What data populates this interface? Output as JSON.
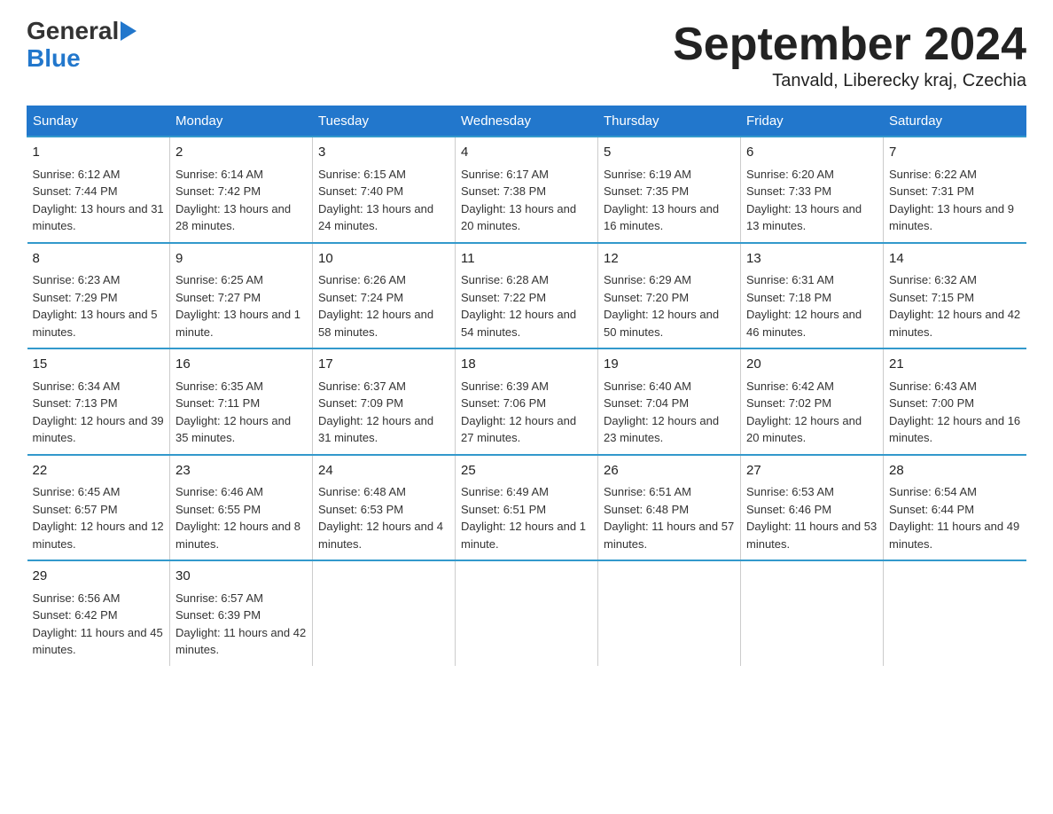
{
  "logo": {
    "general": "General",
    "blue": "Blue"
  },
  "title": "September 2024",
  "subtitle": "Tanvald, Liberecky kraj, Czechia",
  "weekdays": [
    "Sunday",
    "Monday",
    "Tuesday",
    "Wednesday",
    "Thursday",
    "Friday",
    "Saturday"
  ],
  "weeks": [
    [
      {
        "day": "1",
        "sunrise": "Sunrise: 6:12 AM",
        "sunset": "Sunset: 7:44 PM",
        "daylight": "Daylight: 13 hours and 31 minutes."
      },
      {
        "day": "2",
        "sunrise": "Sunrise: 6:14 AM",
        "sunset": "Sunset: 7:42 PM",
        "daylight": "Daylight: 13 hours and 28 minutes."
      },
      {
        "day": "3",
        "sunrise": "Sunrise: 6:15 AM",
        "sunset": "Sunset: 7:40 PM",
        "daylight": "Daylight: 13 hours and 24 minutes."
      },
      {
        "day": "4",
        "sunrise": "Sunrise: 6:17 AM",
        "sunset": "Sunset: 7:38 PM",
        "daylight": "Daylight: 13 hours and 20 minutes."
      },
      {
        "day": "5",
        "sunrise": "Sunrise: 6:19 AM",
        "sunset": "Sunset: 7:35 PM",
        "daylight": "Daylight: 13 hours and 16 minutes."
      },
      {
        "day": "6",
        "sunrise": "Sunrise: 6:20 AM",
        "sunset": "Sunset: 7:33 PM",
        "daylight": "Daylight: 13 hours and 13 minutes."
      },
      {
        "day": "7",
        "sunrise": "Sunrise: 6:22 AM",
        "sunset": "Sunset: 7:31 PM",
        "daylight": "Daylight: 13 hours and 9 minutes."
      }
    ],
    [
      {
        "day": "8",
        "sunrise": "Sunrise: 6:23 AM",
        "sunset": "Sunset: 7:29 PM",
        "daylight": "Daylight: 13 hours and 5 minutes."
      },
      {
        "day": "9",
        "sunrise": "Sunrise: 6:25 AM",
        "sunset": "Sunset: 7:27 PM",
        "daylight": "Daylight: 13 hours and 1 minute."
      },
      {
        "day": "10",
        "sunrise": "Sunrise: 6:26 AM",
        "sunset": "Sunset: 7:24 PM",
        "daylight": "Daylight: 12 hours and 58 minutes."
      },
      {
        "day": "11",
        "sunrise": "Sunrise: 6:28 AM",
        "sunset": "Sunset: 7:22 PM",
        "daylight": "Daylight: 12 hours and 54 minutes."
      },
      {
        "day": "12",
        "sunrise": "Sunrise: 6:29 AM",
        "sunset": "Sunset: 7:20 PM",
        "daylight": "Daylight: 12 hours and 50 minutes."
      },
      {
        "day": "13",
        "sunrise": "Sunrise: 6:31 AM",
        "sunset": "Sunset: 7:18 PM",
        "daylight": "Daylight: 12 hours and 46 minutes."
      },
      {
        "day": "14",
        "sunrise": "Sunrise: 6:32 AM",
        "sunset": "Sunset: 7:15 PM",
        "daylight": "Daylight: 12 hours and 42 minutes."
      }
    ],
    [
      {
        "day": "15",
        "sunrise": "Sunrise: 6:34 AM",
        "sunset": "Sunset: 7:13 PM",
        "daylight": "Daylight: 12 hours and 39 minutes."
      },
      {
        "day": "16",
        "sunrise": "Sunrise: 6:35 AM",
        "sunset": "Sunset: 7:11 PM",
        "daylight": "Daylight: 12 hours and 35 minutes."
      },
      {
        "day": "17",
        "sunrise": "Sunrise: 6:37 AM",
        "sunset": "Sunset: 7:09 PM",
        "daylight": "Daylight: 12 hours and 31 minutes."
      },
      {
        "day": "18",
        "sunrise": "Sunrise: 6:39 AM",
        "sunset": "Sunset: 7:06 PM",
        "daylight": "Daylight: 12 hours and 27 minutes."
      },
      {
        "day": "19",
        "sunrise": "Sunrise: 6:40 AM",
        "sunset": "Sunset: 7:04 PM",
        "daylight": "Daylight: 12 hours and 23 minutes."
      },
      {
        "day": "20",
        "sunrise": "Sunrise: 6:42 AM",
        "sunset": "Sunset: 7:02 PM",
        "daylight": "Daylight: 12 hours and 20 minutes."
      },
      {
        "day": "21",
        "sunrise": "Sunrise: 6:43 AM",
        "sunset": "Sunset: 7:00 PM",
        "daylight": "Daylight: 12 hours and 16 minutes."
      }
    ],
    [
      {
        "day": "22",
        "sunrise": "Sunrise: 6:45 AM",
        "sunset": "Sunset: 6:57 PM",
        "daylight": "Daylight: 12 hours and 12 minutes."
      },
      {
        "day": "23",
        "sunrise": "Sunrise: 6:46 AM",
        "sunset": "Sunset: 6:55 PM",
        "daylight": "Daylight: 12 hours and 8 minutes."
      },
      {
        "day": "24",
        "sunrise": "Sunrise: 6:48 AM",
        "sunset": "Sunset: 6:53 PM",
        "daylight": "Daylight: 12 hours and 4 minutes."
      },
      {
        "day": "25",
        "sunrise": "Sunrise: 6:49 AM",
        "sunset": "Sunset: 6:51 PM",
        "daylight": "Daylight: 12 hours and 1 minute."
      },
      {
        "day": "26",
        "sunrise": "Sunrise: 6:51 AM",
        "sunset": "Sunset: 6:48 PM",
        "daylight": "Daylight: 11 hours and 57 minutes."
      },
      {
        "day": "27",
        "sunrise": "Sunrise: 6:53 AM",
        "sunset": "Sunset: 6:46 PM",
        "daylight": "Daylight: 11 hours and 53 minutes."
      },
      {
        "day": "28",
        "sunrise": "Sunrise: 6:54 AM",
        "sunset": "Sunset: 6:44 PM",
        "daylight": "Daylight: 11 hours and 49 minutes."
      }
    ],
    [
      {
        "day": "29",
        "sunrise": "Sunrise: 6:56 AM",
        "sunset": "Sunset: 6:42 PM",
        "daylight": "Daylight: 11 hours and 45 minutes."
      },
      {
        "day": "30",
        "sunrise": "Sunrise: 6:57 AM",
        "sunset": "Sunset: 6:39 PM",
        "daylight": "Daylight: 11 hours and 42 minutes."
      },
      null,
      null,
      null,
      null,
      null
    ]
  ]
}
